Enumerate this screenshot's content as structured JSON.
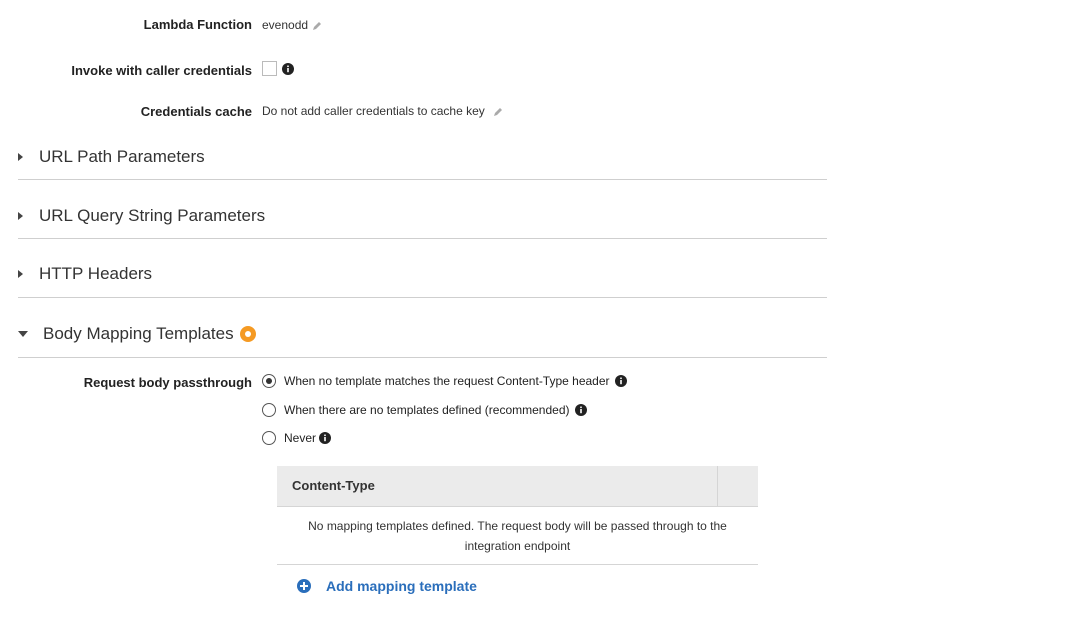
{
  "integration": {
    "lambda_function": {
      "label": "Lambda Function",
      "value": "evenodd"
    },
    "invoke_caller": {
      "label": "Invoke with caller credentials",
      "checked": false
    },
    "credentials_cache": {
      "label": "Credentials cache",
      "value": "Do not add caller credentials to cache key"
    }
  },
  "sections": {
    "url_path": "URL Path Parameters",
    "url_query": "URL Query String Parameters",
    "http_headers": "HTTP Headers",
    "body_mapping": "Body Mapping Templates"
  },
  "body_mapping": {
    "passthrough_label": "Request body passthrough",
    "options": [
      {
        "label": "When no template matches the request Content-Type header",
        "selected": true
      },
      {
        "label": "When there are no templates defined (recommended)",
        "selected": false
      },
      {
        "label": "Never",
        "selected": false
      }
    ],
    "table": {
      "header": "Content-Type",
      "empty_message": "No mapping templates defined. The request body will be passed through to the integration endpoint"
    },
    "add_label": "Add mapping template"
  },
  "colors": {
    "link": "#2a6ebb",
    "badge": "#f59a23"
  },
  "icons": [
    "pencil-icon",
    "info-icon",
    "caret-right-icon",
    "caret-down-icon",
    "plus-circle-icon",
    "radio-selected-icon"
  ]
}
